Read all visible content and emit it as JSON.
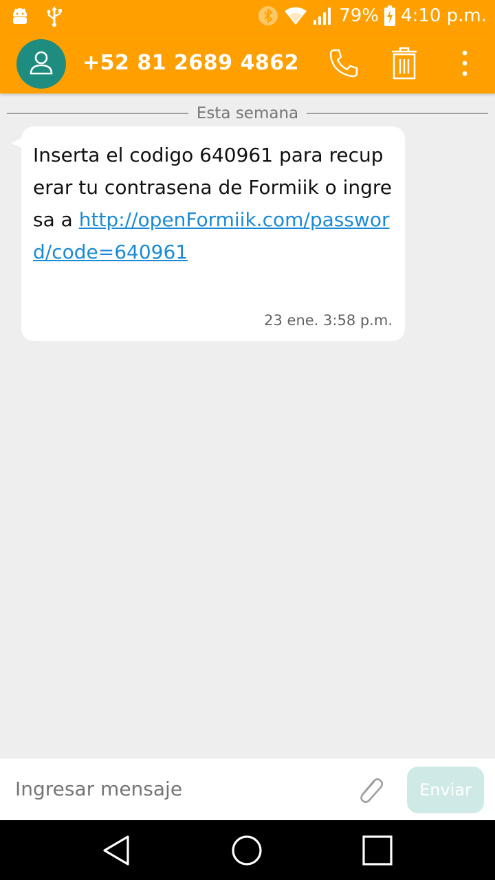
{
  "status_bar": {
    "battery": "79%",
    "time": "4:10 p.m.",
    "icons": [
      "android-debug-icon",
      "usb-icon",
      "bluetooth-icon",
      "wifi-icon",
      "signal-icon",
      "battery-charging-icon"
    ]
  },
  "app_bar": {
    "contact": "+52 81 2689 4862",
    "icons": [
      "avatar-person-icon",
      "phone-icon",
      "trash-icon",
      "overflow-menu-icon"
    ]
  },
  "conversation": {
    "date_divider": "Esta semana",
    "messages": [
      {
        "text_before": "Inserta el codigo 640961 para recuperar tu contrasena de Formiik o ingresa a  ",
        "link": "http://openFormiik.com/password/code=640961",
        "time": "23 ene. 3:58 p.m."
      }
    ]
  },
  "compose": {
    "placeholder": "Ingresar mensaje",
    "send_label": "Enviar",
    "attach_icon": "paperclip-icon"
  },
  "nav_bar": {
    "icons": [
      "back-icon",
      "home-icon",
      "recents-icon"
    ]
  },
  "colors": {
    "accent": "#ffa000",
    "avatar": "#1e8c7e",
    "link": "#1a8ad6",
    "send_disabled": "#cfeae6"
  }
}
